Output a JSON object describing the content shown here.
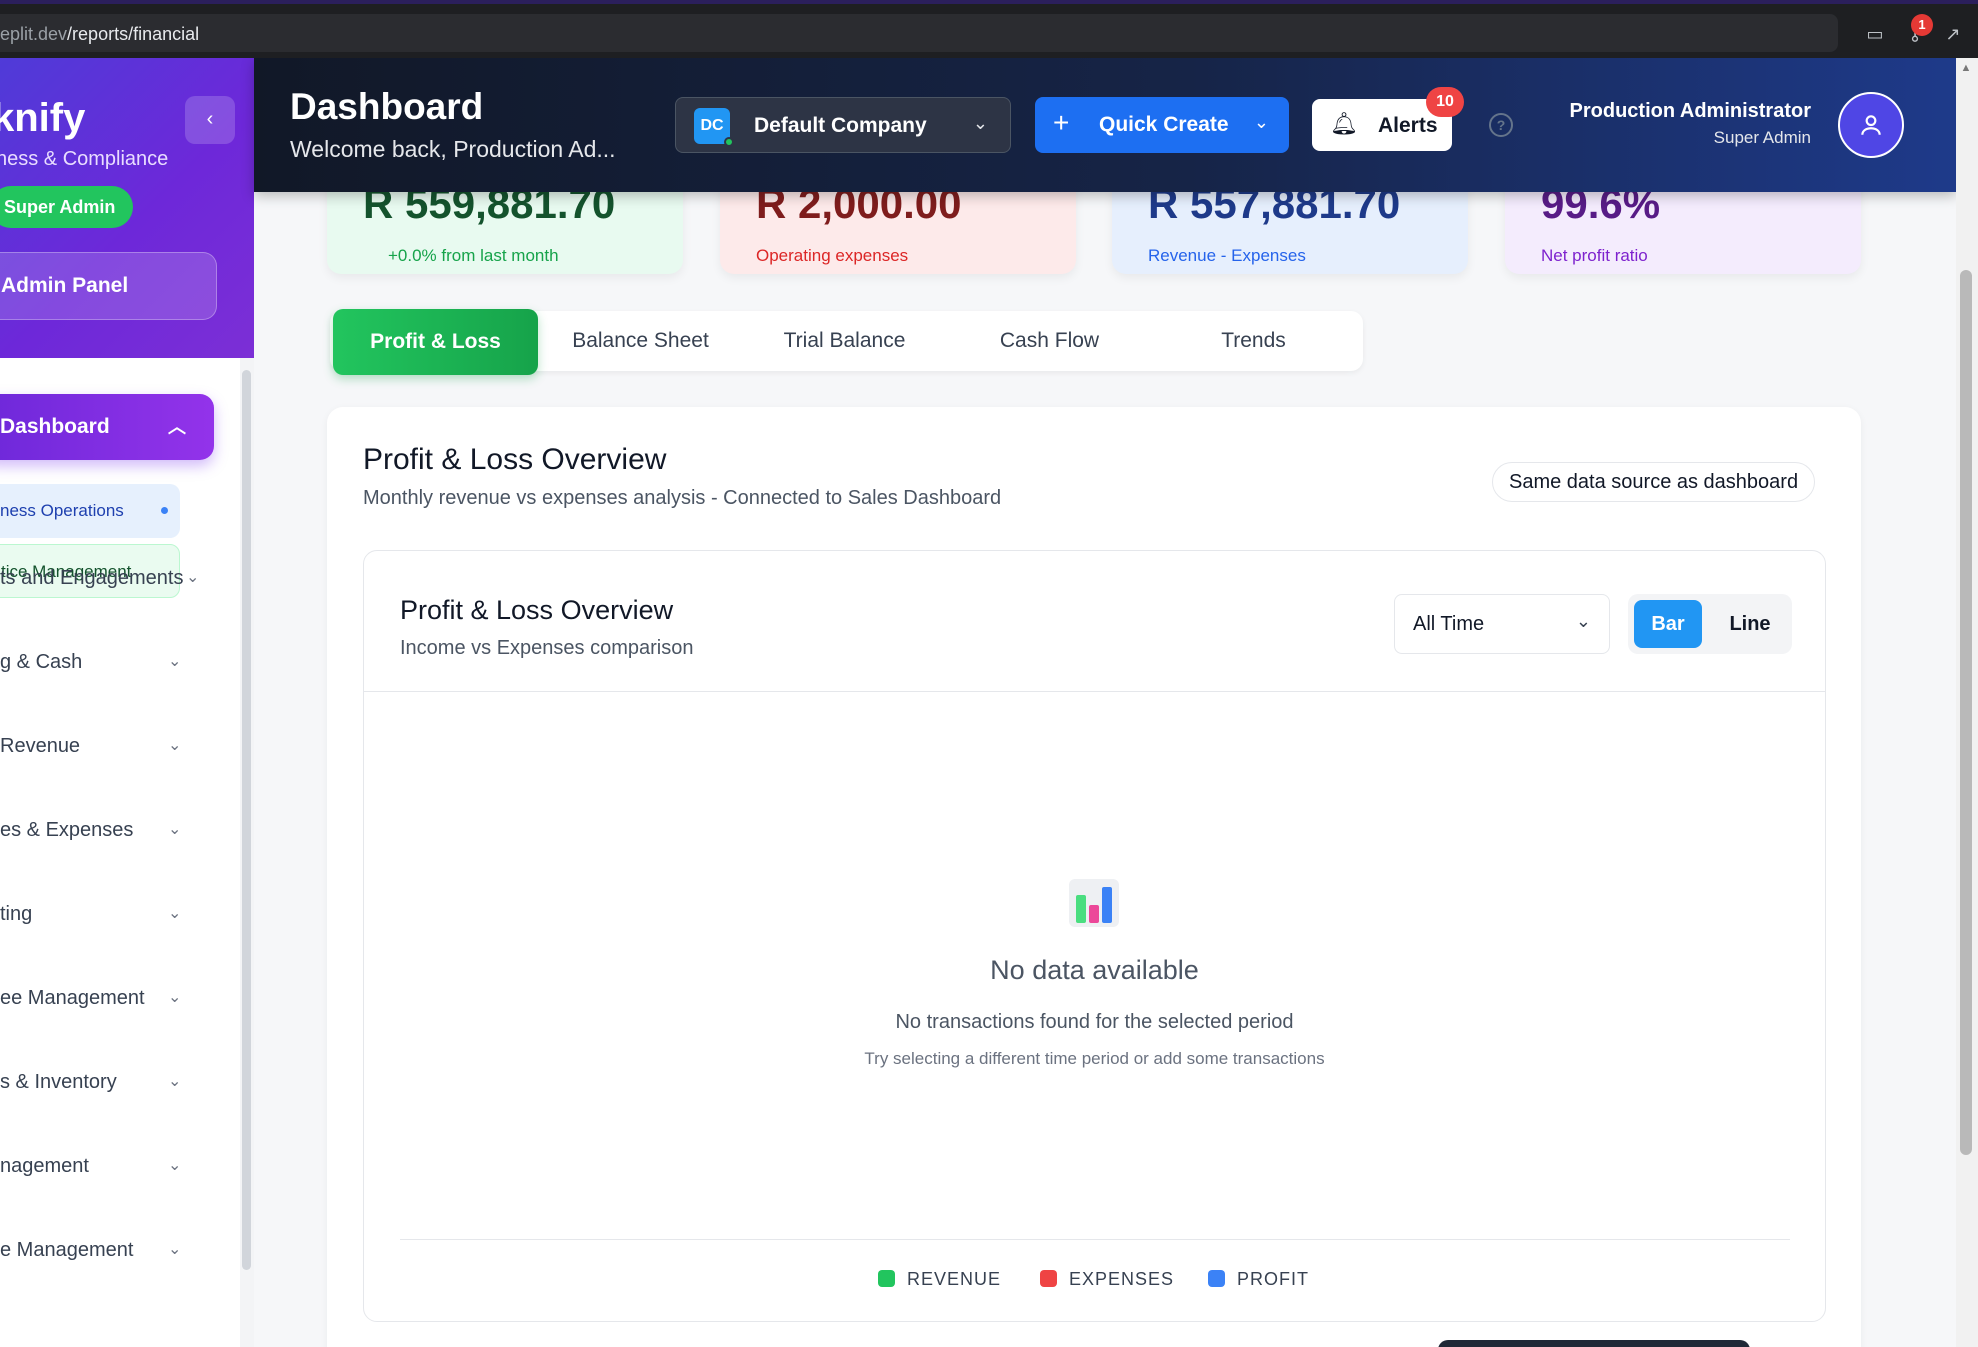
{
  "browser": {
    "url_host": "eplit.dev",
    "url_path": "/reports/financial",
    "extension_badge": "1"
  },
  "sidebar": {
    "brand": "knify",
    "brand_sub": "ness & Compliance",
    "role_badge": "Super Admin",
    "admin_panel": "Admin Panel",
    "active_item": "Dashboard",
    "sub_items": [
      {
        "label": "ness Operations"
      },
      {
        "label": "tice Management"
      }
    ],
    "items": [
      {
        "label": "ts and Engagements"
      },
      {
        "label": "g & Cash"
      },
      {
        "label": "Revenue"
      },
      {
        "label": "es & Expenses"
      },
      {
        "label": "ting"
      },
      {
        "label": "ee Management"
      },
      {
        "label": "s & Inventory"
      },
      {
        "label": "nagement"
      },
      {
        "label": "e Management"
      }
    ]
  },
  "header": {
    "title": "Dashboard",
    "welcome": "Welcome back, Production Ad...",
    "company_initials": "DC",
    "company_name": "Default Company",
    "quick_create": "Quick Create",
    "alerts_label": "Alerts",
    "alerts_count": "10",
    "user_name": "Production Administrator",
    "user_role": "Super Admin"
  },
  "stats": [
    {
      "value": "R 559,881.70",
      "sub": "+0.0% from last month",
      "color": "#16a34a"
    },
    {
      "value": "R 2,000.00",
      "sub": "Operating expenses",
      "color": "#dc2626"
    },
    {
      "value": "R 557,881.70",
      "sub": "Revenue - Expenses",
      "color": "#2563eb"
    },
    {
      "value": "99.6%",
      "sub": "Net profit ratio",
      "color": "#7e22ce"
    }
  ],
  "tabs": [
    {
      "label": "Profit & Loss",
      "active": true
    },
    {
      "label": "Balance Sheet",
      "active": false
    },
    {
      "label": "Trial Balance",
      "active": false
    },
    {
      "label": "Cash Flow",
      "active": false
    },
    {
      "label": "Trends",
      "active": false
    }
  ],
  "overview": {
    "title": "Profit & Loss Overview",
    "subtitle": "Monthly revenue vs expenses analysis - Connected to Sales Dashboard",
    "source_pill": "Same data source as dashboard"
  },
  "chart_card": {
    "title": "Profit & Loss Overview",
    "subtitle": "Income vs Expenses comparison",
    "period": "All Time",
    "toggle_bar": "Bar",
    "toggle_line": "Line",
    "empty_title": "No data available",
    "empty_sub": "No transactions found for the selected period",
    "empty_hint": "Try selecting a different time period or add some transactions",
    "legend": [
      {
        "label": "REVENUE",
        "color": "#22c55e"
      },
      {
        "label": "EXPENSES",
        "color": "#ef4444"
      },
      {
        "label": "PROFIT",
        "color": "#3b82f6"
      }
    ]
  }
}
